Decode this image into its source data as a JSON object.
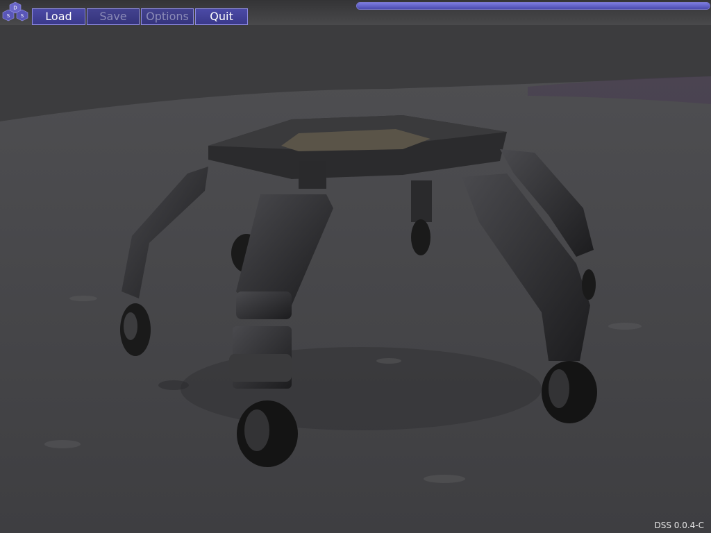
{
  "app": {
    "logo_letters": [
      "D",
      "S",
      "S"
    ],
    "version": "DSS 0.0.4-C"
  },
  "toolbar": {
    "load_label": "Load",
    "save_label": "Save",
    "options_label": "Options",
    "quit_label": "Quit"
  },
  "progress": {
    "value": 1.0
  },
  "colors": {
    "ui_accent": "#8e8ae0",
    "ui_button_bg": "#3f3e98",
    "terrain": "#4a4a4c",
    "rover": "#2a2a2c"
  }
}
